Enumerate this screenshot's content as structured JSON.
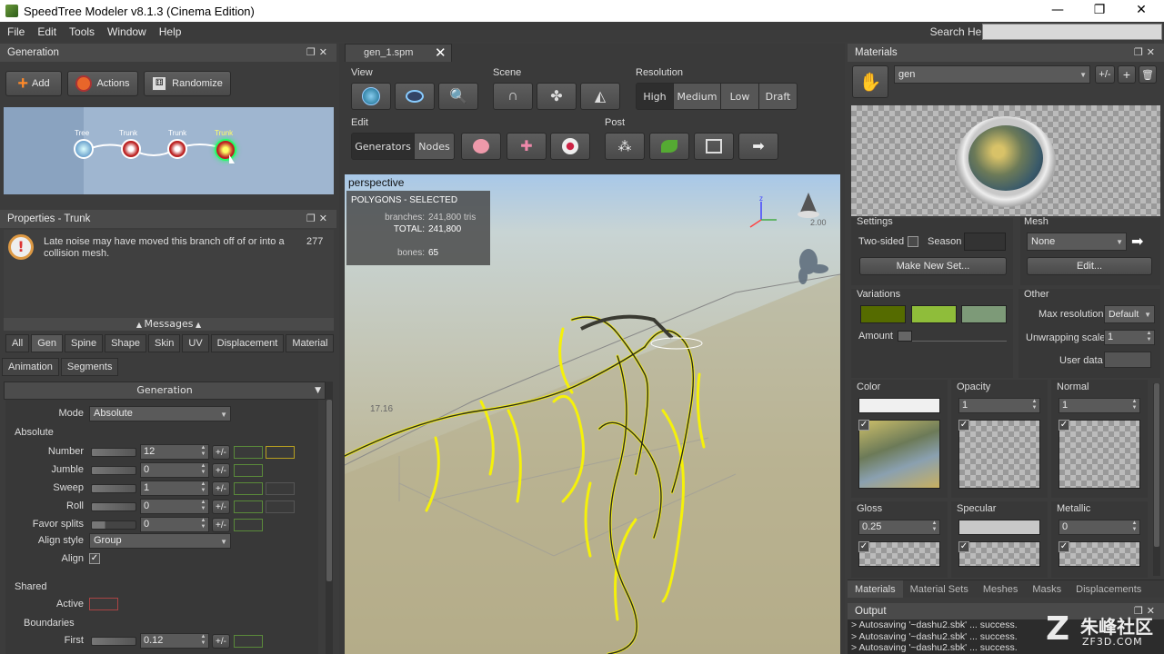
{
  "window": {
    "title": "SpeedTree Modeler v8.1.3 (Cinema Edition)",
    "minimize": "—",
    "maximize": "❐",
    "close": "✕"
  },
  "menu": [
    "File",
    "Edit",
    "Tools",
    "Window",
    "Help"
  ],
  "search": {
    "label": "Search Help:",
    "value": ""
  },
  "generation": {
    "title": "Generation",
    "add": "Add",
    "actions": "Actions",
    "randomize": "Randomize",
    "nodes": [
      "Tree",
      "Trunk",
      "Trunk",
      "Trunk"
    ]
  },
  "properties": {
    "title": "Properties - Trunk",
    "message": "Late noise may have moved this branch off of or into a collision mesh.",
    "message_count": "277",
    "messages_label": "Messages",
    "tabs": [
      "All",
      "Gen",
      "Spine",
      "Shape",
      "Skin",
      "UV",
      "Displacement",
      "Material"
    ],
    "tabs2": [
      "Animation",
      "Segments"
    ],
    "section": "Generation",
    "mode_label": "Mode",
    "mode_value": "Absolute",
    "absolute_label": "Absolute",
    "rows": [
      {
        "label": "Number",
        "value": "12"
      },
      {
        "label": "Jumble",
        "value": "0"
      },
      {
        "label": "Sweep",
        "value": "1"
      },
      {
        "label": "Roll",
        "value": "0"
      },
      {
        "label": "Favor splits",
        "value": "0"
      }
    ],
    "align_style_label": "Align style",
    "align_style_value": "Group",
    "align_label": "Align",
    "shared_label": "Shared",
    "active_label": "Active",
    "boundaries_label": "Boundaries",
    "first_label": "First",
    "first_value": "0.12",
    "pm": "+/-"
  },
  "viewport": {
    "tab": "gen_1.spm",
    "tab_close": "✕",
    "view_label": "View",
    "scene_label": "Scene",
    "resolution_label": "Resolution",
    "resolution": [
      "High",
      "Medium",
      "Low",
      "Draft"
    ],
    "edit_label": "Edit",
    "edit_generators": "Generators",
    "edit_nodes": "Nodes",
    "post_label": "Post",
    "perspective": "perspective",
    "overlay_title": "POLYGONS - SELECTED",
    "branches_label": "branches:",
    "branches_value": "241,800 tris",
    "total_label": "TOTAL:",
    "total_value": "241,800",
    "bones_label": "bones:",
    "bones_value": "65",
    "grid_value": "17.16",
    "light_value": "2.00",
    "axis_z": "z"
  },
  "materials": {
    "title": "Materials",
    "name": "gen",
    "pm": "+/-",
    "settings_label": "Settings",
    "two_sided": "Two-sided",
    "season": "Season",
    "make_new_set": "Make New Set...",
    "mesh_label": "Mesh",
    "mesh_value": "None",
    "edit_btn": "Edit...",
    "variations_label": "Variations",
    "amount_label": "Amount",
    "variation_colors": [
      "#556b00",
      "#8fbd3a",
      "#7d9a78"
    ],
    "other_label": "Other",
    "max_res_label": "Max resolution",
    "max_res_value": "Default",
    "unwrap_label": "Unwrapping scale",
    "unwrap_value": "1",
    "user_data_label": "User data",
    "color_label": "Color",
    "opacity_label": "Opacity",
    "opacity_value": "1",
    "normal_label": "Normal",
    "normal_value": "1",
    "gloss_label": "Gloss",
    "gloss_value": "0.25",
    "specular_label": "Specular",
    "metallic_label": "Metallic",
    "metallic_value": "0",
    "bottom_tabs": [
      "Materials",
      "Material Sets",
      "Meshes",
      "Masks",
      "Displacements"
    ]
  },
  "output": {
    "title": "Output",
    "lines": [
      "> Autosaving '~dashu2.sbk' ... success.",
      "> Autosaving '~dashu2.sbk' ... success.",
      "> Autosaving '~dashu2.sbk' ... success."
    ]
  },
  "watermark": {
    "text": "朱峰社区",
    "sub": "ZF3D.COM"
  }
}
